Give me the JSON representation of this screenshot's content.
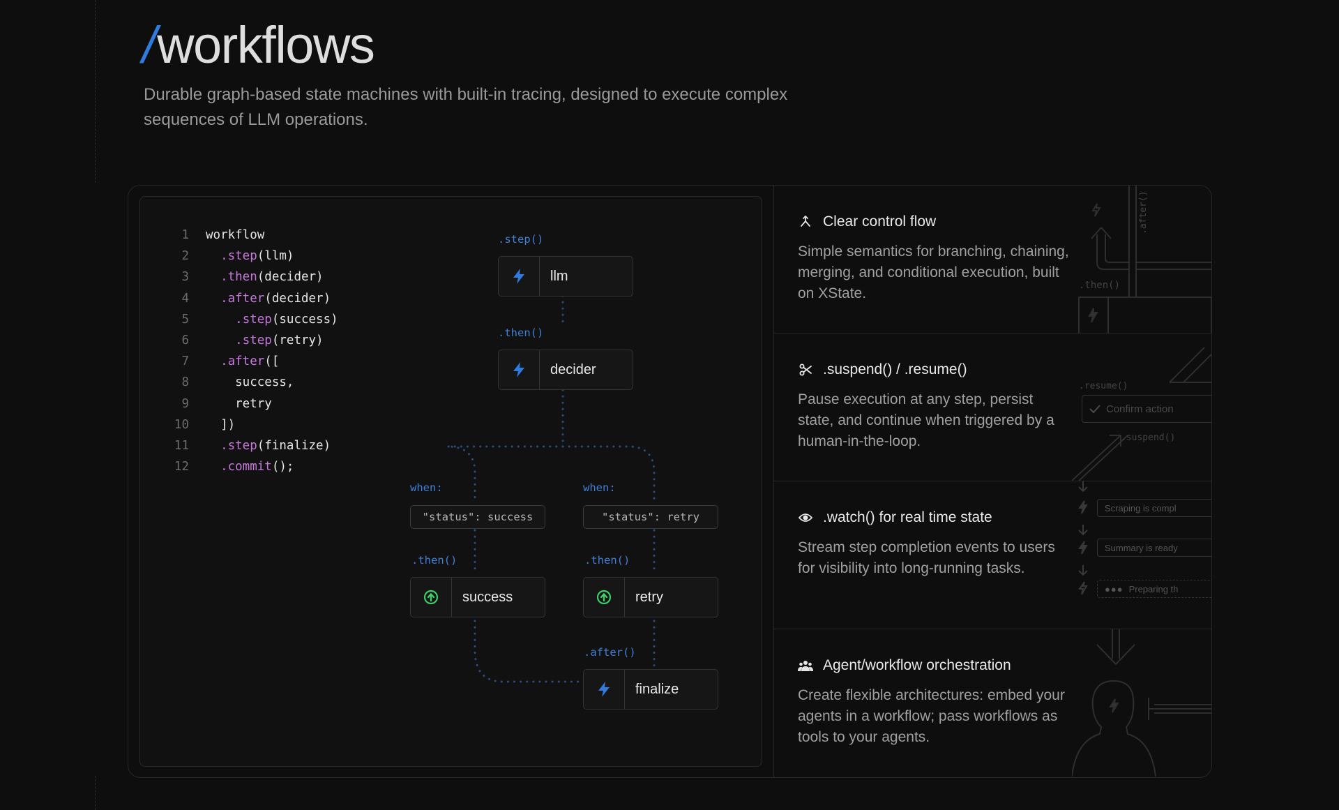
{
  "header": {
    "slash": "/",
    "title": "workflows",
    "subtitle": "Durable graph-based state machines with built-in tracing, designed to execute complex sequences of LLM operations."
  },
  "code": {
    "lines": [
      {
        "n": "1",
        "segs": [
          {
            "t": "workflow"
          }
        ]
      },
      {
        "n": "2",
        "segs": [
          {
            "t": "  "
          },
          {
            "t": ".step",
            "k": 1
          },
          {
            "t": "(llm)"
          }
        ]
      },
      {
        "n": "3",
        "segs": [
          {
            "t": "  "
          },
          {
            "t": ".then",
            "k": 1
          },
          {
            "t": "(decider)"
          }
        ]
      },
      {
        "n": "4",
        "segs": [
          {
            "t": "  "
          },
          {
            "t": ".after",
            "k": 1
          },
          {
            "t": "(decider)"
          }
        ]
      },
      {
        "n": "5",
        "segs": [
          {
            "t": "    "
          },
          {
            "t": ".step",
            "k": 1
          },
          {
            "t": "(success)"
          }
        ]
      },
      {
        "n": "6",
        "segs": [
          {
            "t": "    "
          },
          {
            "t": ".step",
            "k": 1
          },
          {
            "t": "(retry)"
          }
        ]
      },
      {
        "n": "7",
        "segs": [
          {
            "t": "  "
          },
          {
            "t": ".after",
            "k": 1
          },
          {
            "t": "(["
          }
        ]
      },
      {
        "n": "8",
        "segs": [
          {
            "t": "    success,"
          }
        ]
      },
      {
        "n": "9",
        "segs": [
          {
            "t": "    retry"
          }
        ]
      },
      {
        "n": "10",
        "segs": [
          {
            "t": "  ])"
          }
        ]
      },
      {
        "n": "11",
        "segs": [
          {
            "t": "  "
          },
          {
            "t": ".step",
            "k": 1
          },
          {
            "t": "(finalize)"
          }
        ]
      },
      {
        "n": "12",
        "segs": [
          {
            "t": "  "
          },
          {
            "t": ".commit",
            "k": 1
          },
          {
            "t": "();"
          }
        ]
      }
    ]
  },
  "diagram": {
    "labels": {
      "step": ".step()",
      "then1": ".then()",
      "when_left": "when:",
      "when_right": "when:",
      "then_left": ".then()",
      "then_right": ".then()",
      "after": ".after()"
    },
    "conditions": {
      "left": "\"status\": success",
      "right": "\"status\": retry"
    },
    "nodes": {
      "llm": "llm",
      "decider": "decider",
      "success": "success",
      "retry": "retry",
      "finalize": "finalize"
    }
  },
  "features": [
    {
      "icon": "branch-icon",
      "title": "Clear control flow",
      "desc": "Simple semantics for branching, chaining, merging, and conditional execution, built on XState."
    },
    {
      "icon": "scissors-icon",
      "title": ".suspend() / .resume()",
      "desc": "Pause execution at any step, persist state, and continue when triggered by a human-in-the-loop."
    },
    {
      "icon": "eye-icon",
      "title": ".watch() for real time state",
      "desc": "Stream step completion events to users for visibility into long-running tasks."
    },
    {
      "icon": "users-icon",
      "title": "Agent/workflow orchestration",
      "desc": "Create flexible architectures: embed your agents in a workflow; pass workflows as tools to your agents."
    }
  ],
  "art": {
    "f1_after": ".after()",
    "f1_then": ".then()",
    "f2_resume": ".resume()",
    "f2_confirm": "Confirm action",
    "f2_suspend": ".suspend()",
    "f3_item1": "Scraping is compl",
    "f3_item2": "Summary is ready",
    "f3_item3": "Preparing th"
  },
  "colors": {
    "accent": "#2f7be0",
    "keyword": "#c678dd",
    "success": "#3ecf6a"
  }
}
